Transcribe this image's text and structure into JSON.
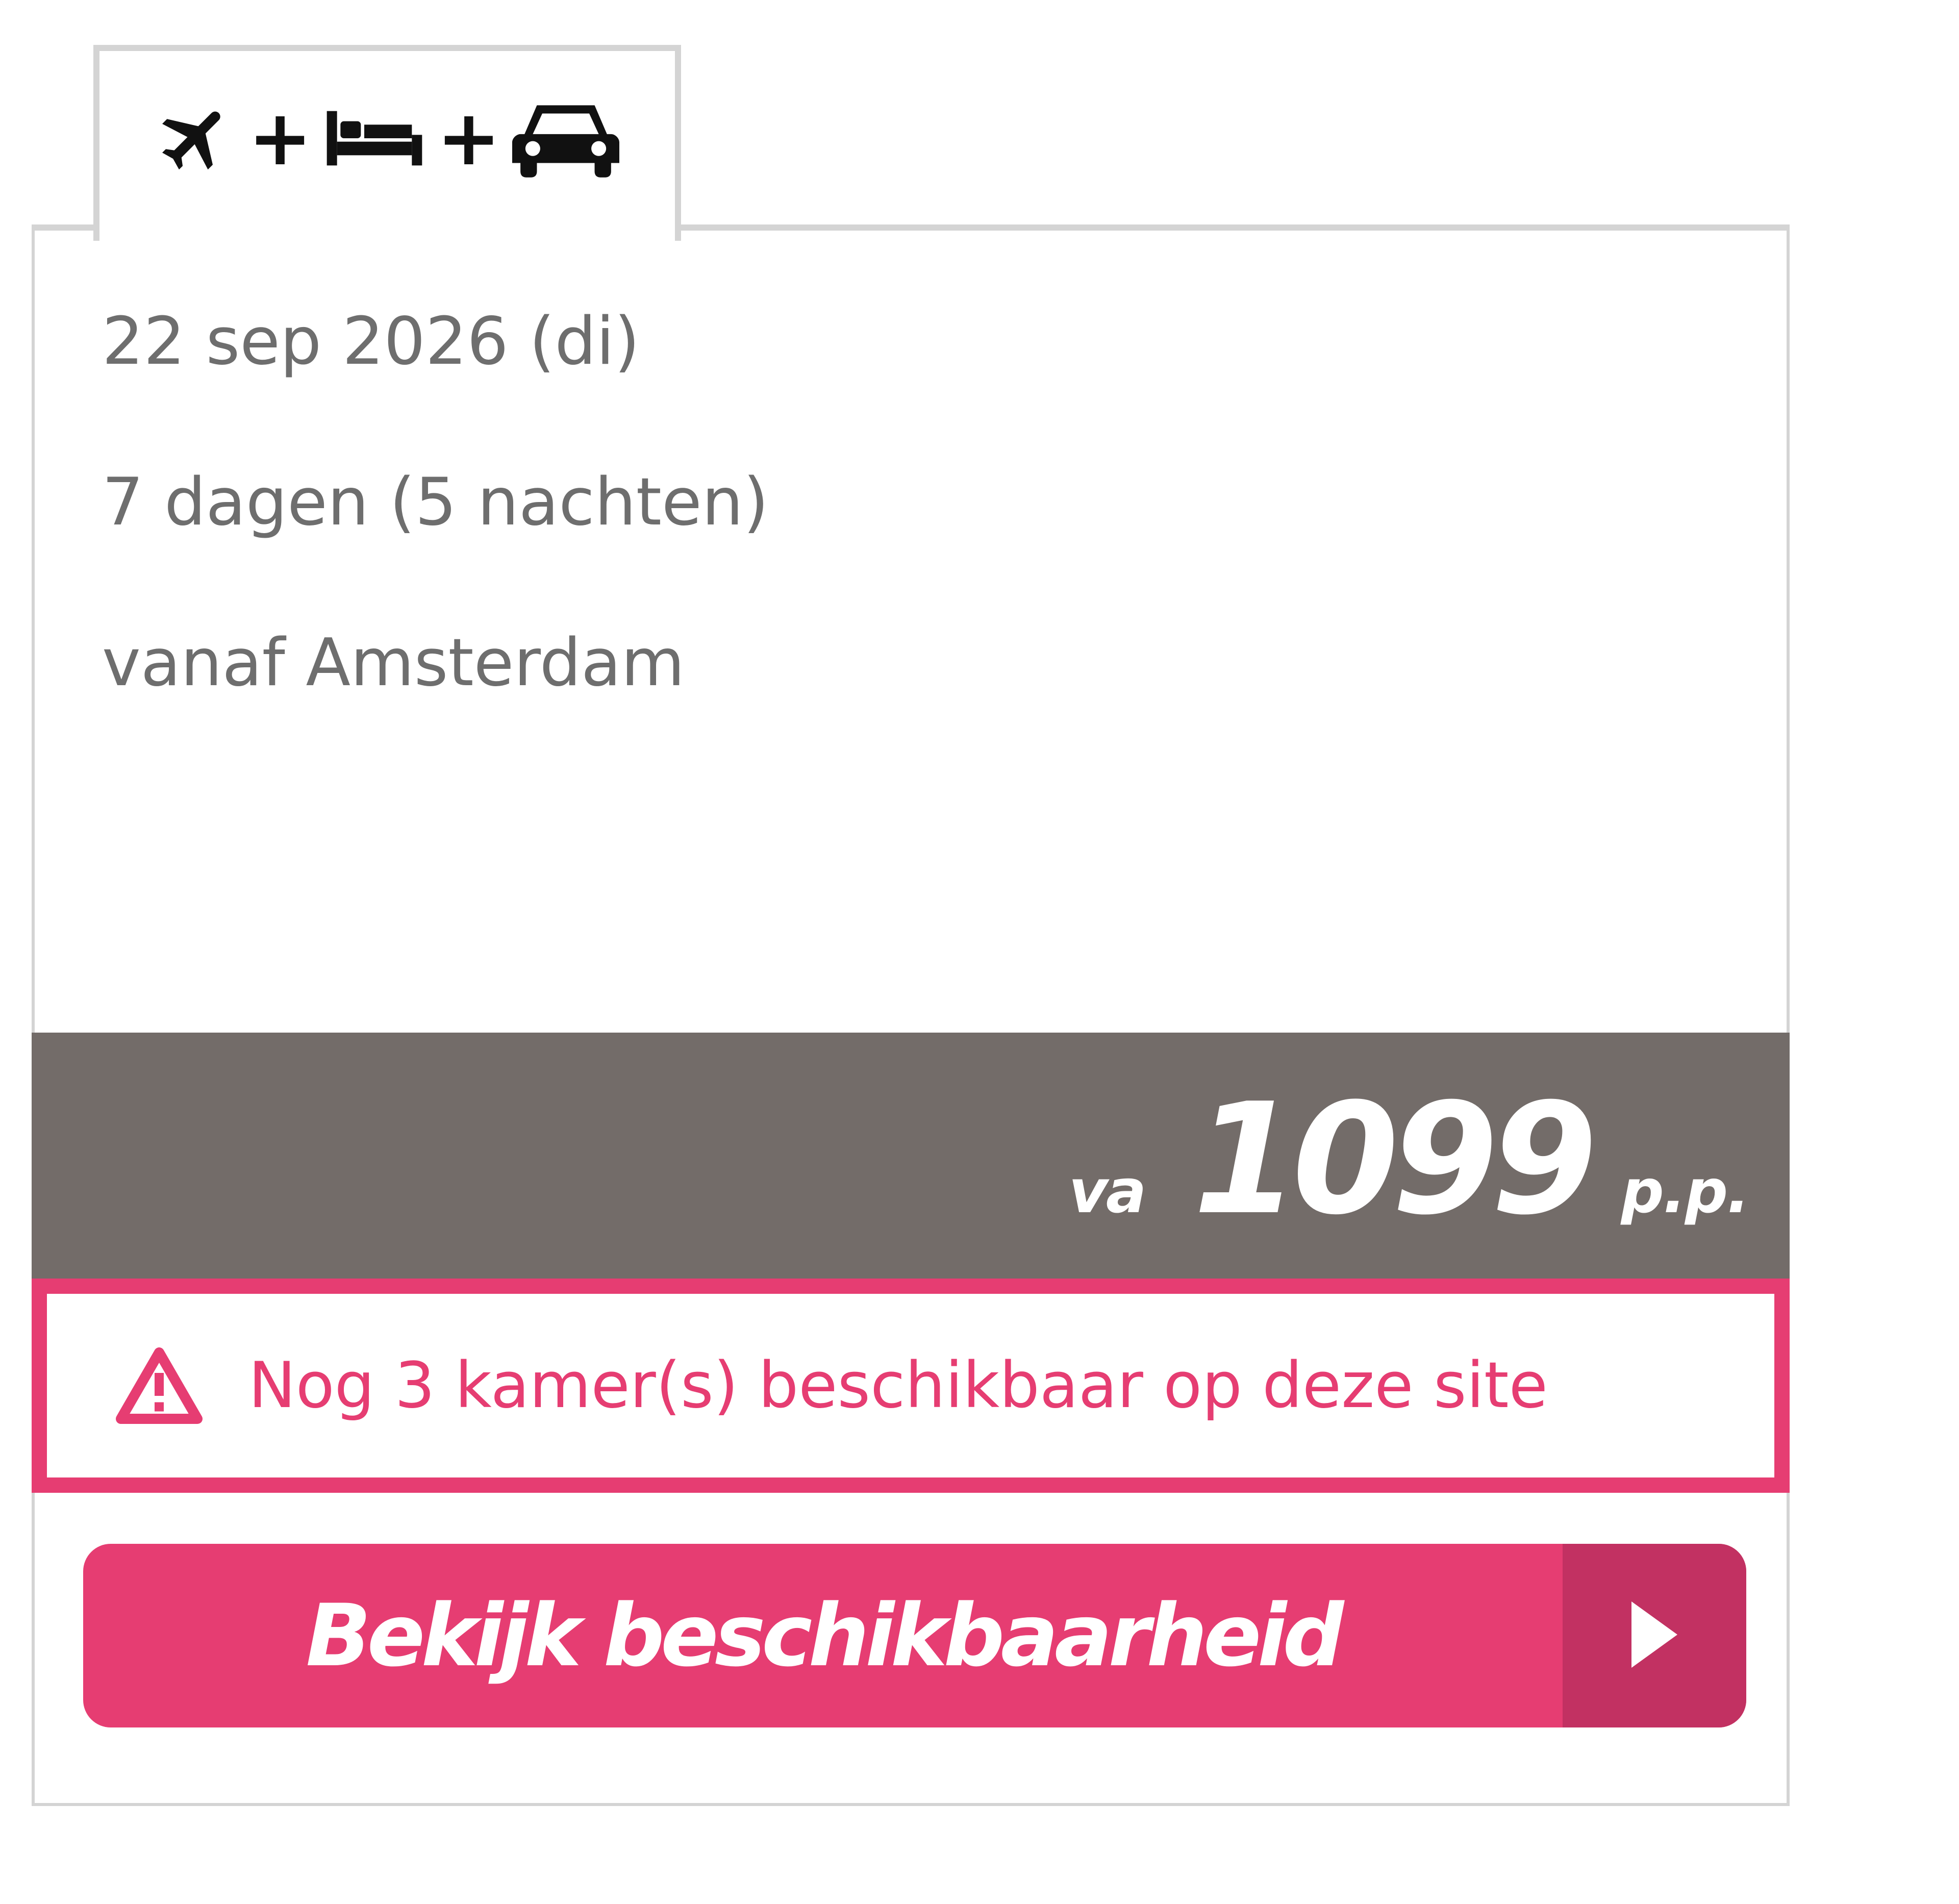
{
  "tab": {
    "icons": [
      "plane-icon",
      "plus",
      "bed-icon",
      "plus",
      "car-icon"
    ],
    "plus_symbol": "+"
  },
  "trip": {
    "departure_date": "22 sep 2026 (di)",
    "duration": "7 dagen (5 nachten)",
    "origin": "vanaf Amsterdam"
  },
  "price": {
    "prefix": "va",
    "amount": "1099",
    "suffix": "p.p."
  },
  "availability": {
    "icon": "warning-icon",
    "message": "Nog 3 kamer(s) beschikbaar op deze site"
  },
  "cta": {
    "label": "Bekijk beschikbaarheid",
    "icon": "play-arrow-icon"
  },
  "colors": {
    "accent": "#e63d72",
    "accent_dark": "#c23162",
    "price_bar": "#736c69",
    "text_muted": "#6e6e6e",
    "border": "#d4d4d4"
  }
}
